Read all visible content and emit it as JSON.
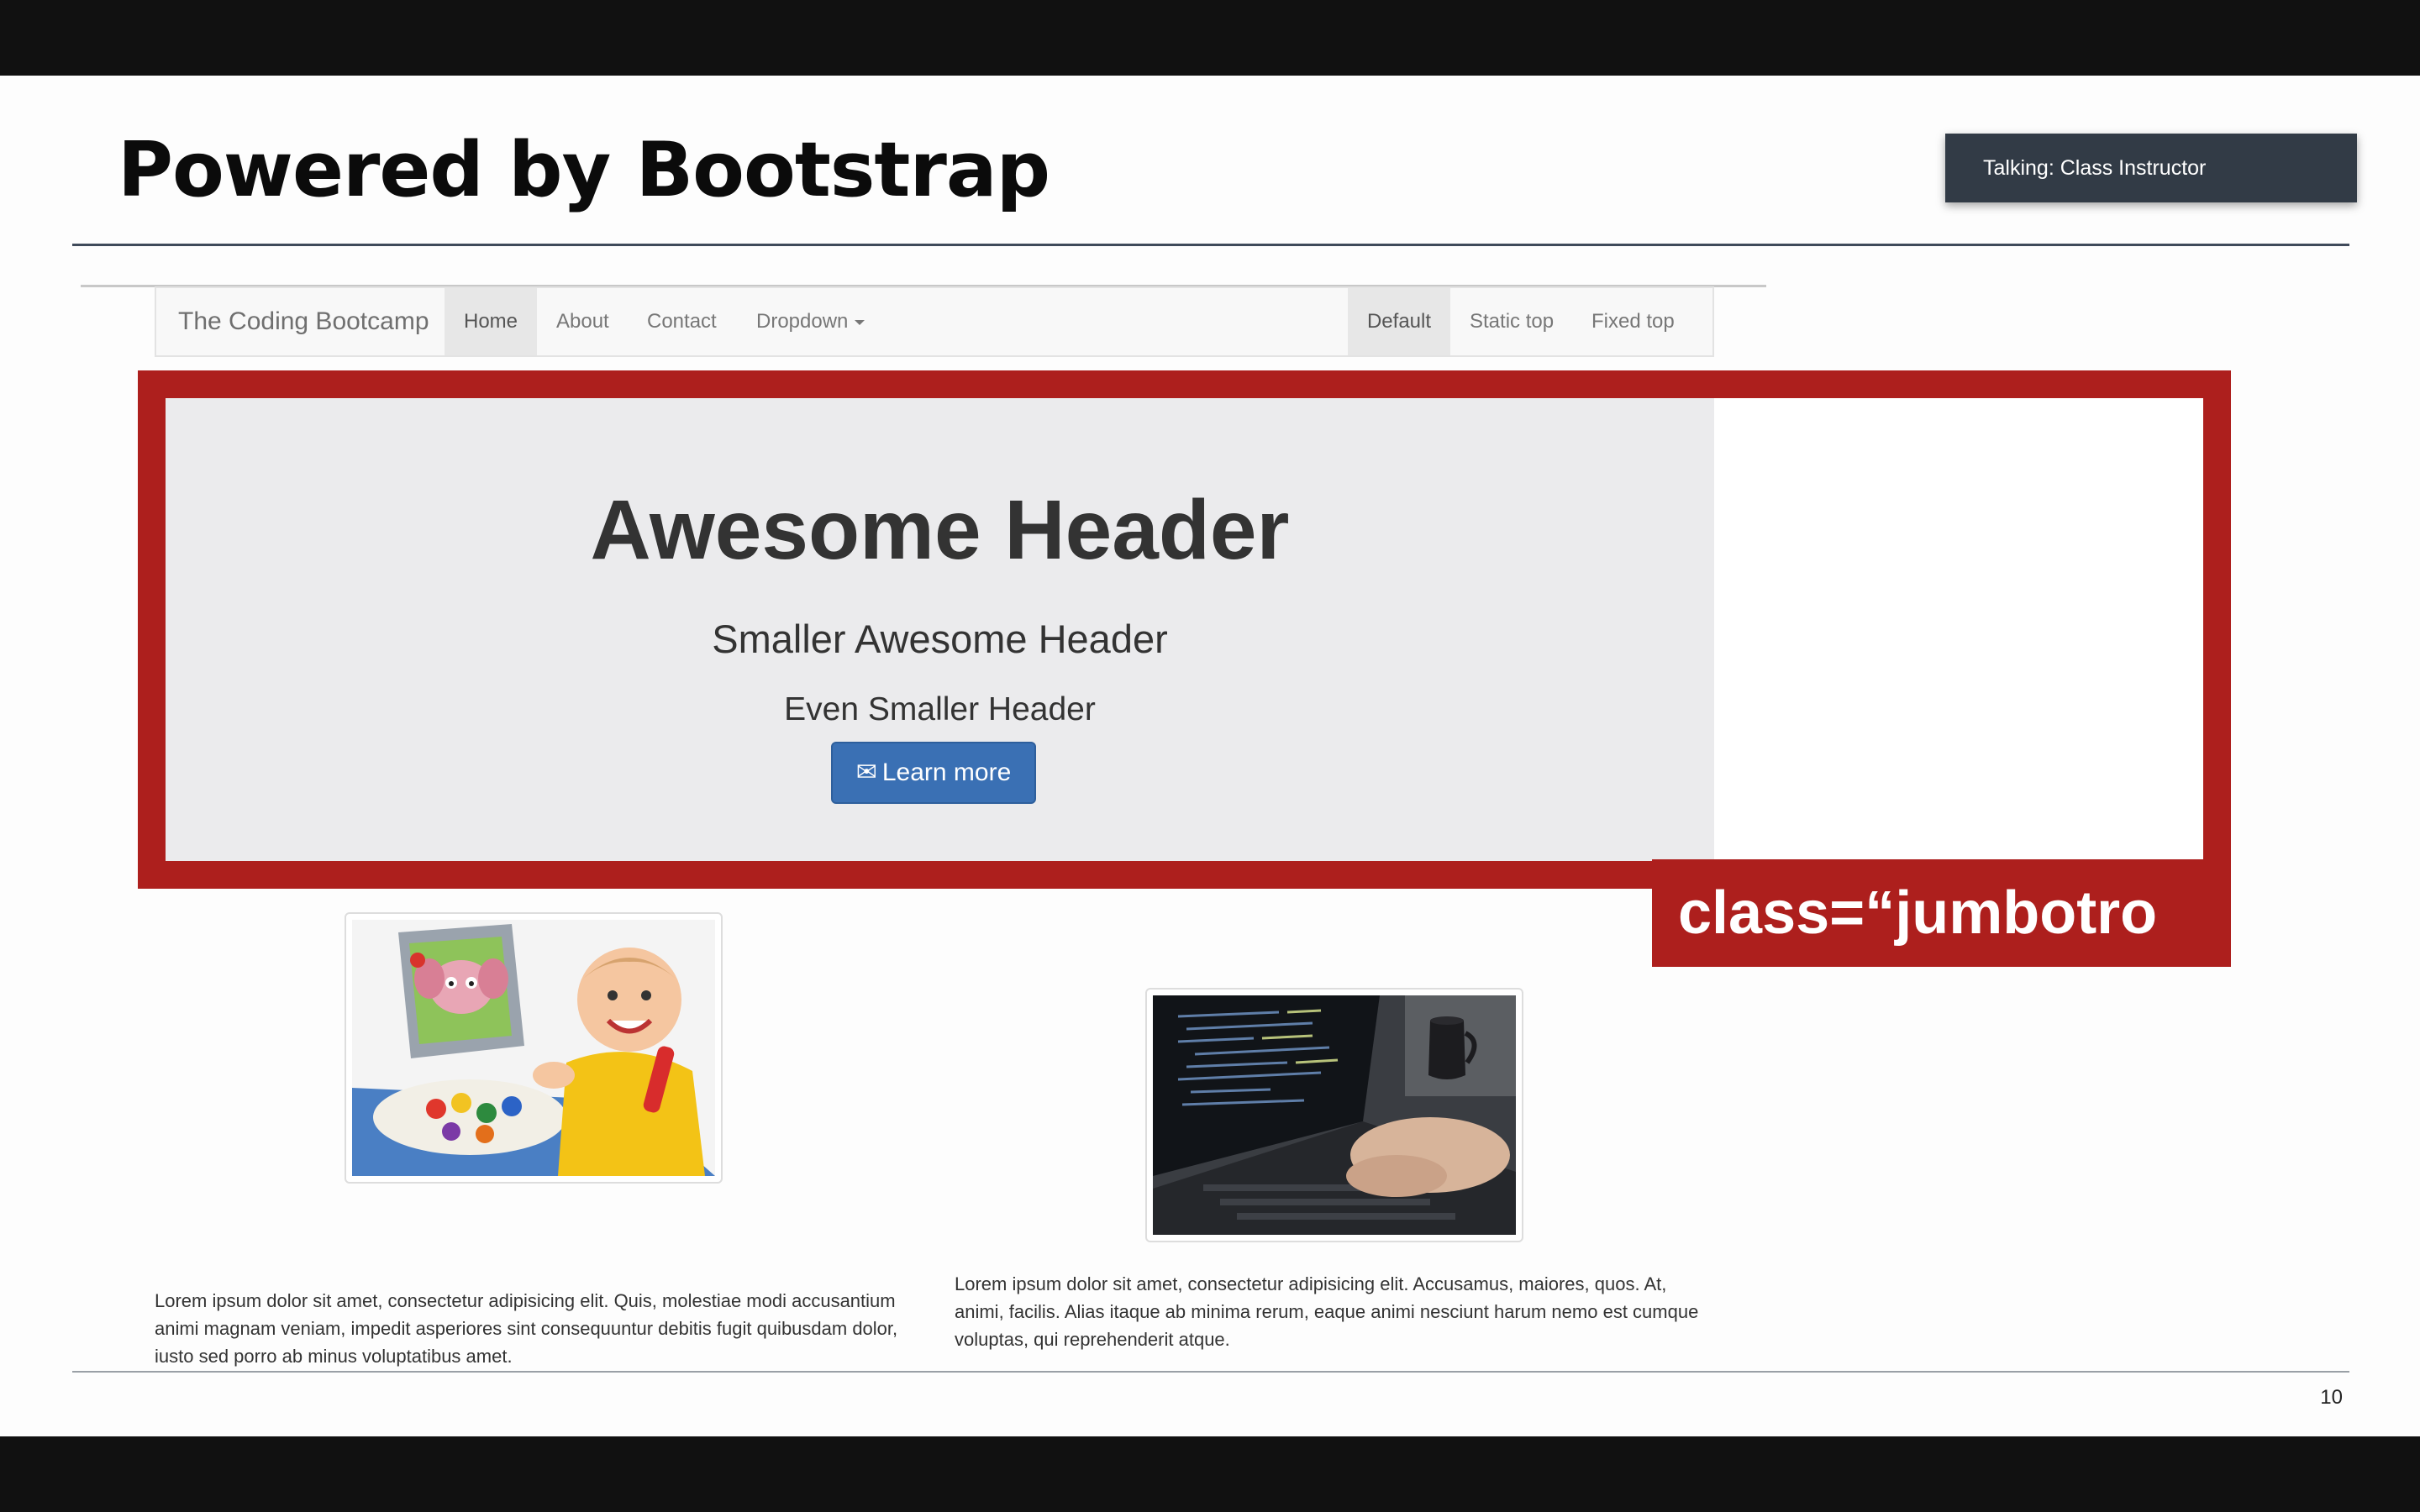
{
  "slide": {
    "title": "Powered by Bootstrap",
    "page_number": "10"
  },
  "toast": {
    "text": "Talking: Class Instructor"
  },
  "navbar": {
    "brand": "The Coding Bootcamp",
    "items": [
      "Home",
      "About",
      "Contact",
      "Dropdown"
    ],
    "right_items": [
      "Default",
      "Static top",
      "Fixed top"
    ],
    "active_left": "Home",
    "active_right": "Default"
  },
  "jumbotron": {
    "h1": "Awesome Header",
    "h2": "Smaller Awesome Header",
    "h3": "Even Smaller Header",
    "button_label": "Learn more",
    "button_icon": "envelope-icon"
  },
  "annotation": {
    "text": "class=“jumbotro"
  },
  "thumbnails": [
    {
      "image": "child-with-elephant-toy-computer",
      "text": "Lorem ipsum dolor sit amet, consectetur adipisicing elit. Quis, molestiae modi accusantium animi magnam veniam, impedit asperiores sint consequuntur debitis fugit quibusdam dolor, iusto sed porro ab minus voluptatibus amet."
    },
    {
      "image": "hands-typing-on-laptop",
      "text": "Lorem ipsum dolor sit amet, consectetur adipisicing elit. Accusamus, maiores, quos. At, animi, facilis. Alias itaque ab minima rerum, eaque animi nesciunt harum nemo est cumque voluptas, qui reprehenderit atque."
    }
  ],
  "colors": {
    "frame_red": "#ad1f1d",
    "button_blue": "#3a70b4",
    "toast_bg": "#323b46"
  }
}
